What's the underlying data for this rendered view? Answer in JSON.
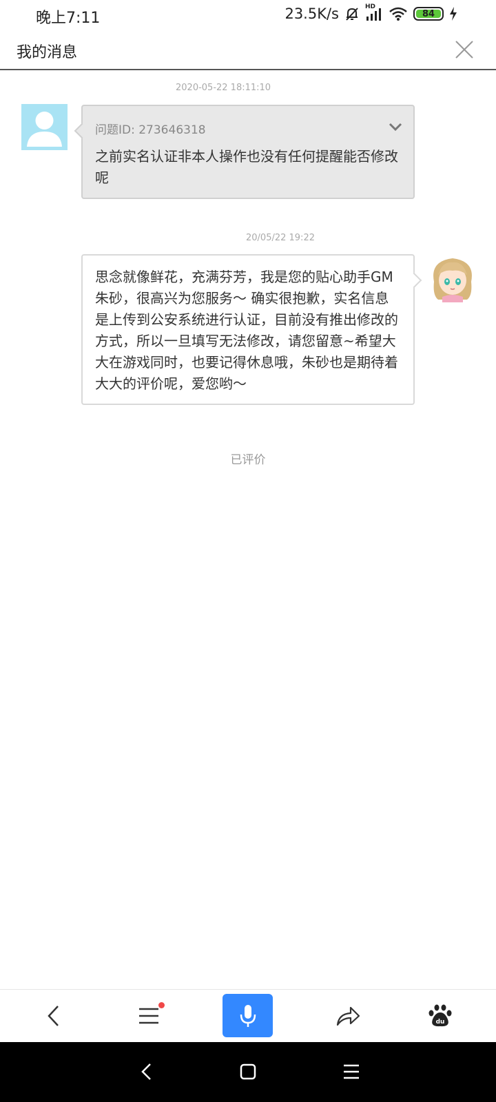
{
  "status": {
    "time": "晚上7:11",
    "net_speed": "23.5K/s",
    "battery": "84",
    "hd_label": "HD"
  },
  "header": {
    "title": "我的消息"
  },
  "messages": [
    {
      "timestamp": "2020-05-22 18:11:10",
      "question_id": "问题ID: 273646318",
      "text": "之前实名认证非本人操作也没有任何提醒能否修改呢"
    },
    {
      "timestamp": "20/05/22 19:22",
      "text": "思念就像鲜花，充满芬芳，我是您的贴心助手GM朱砂，很高兴为您服务～ 确实很抱歉，实名信息是上传到公安系统进行认证，目前没有推出修改的方式，所以一旦填写无法修改，请您留意~希望大大在游戏同时，也要记得休息哦，朱砂也是期待着大大的评价呢，爱您哟～"
    }
  ],
  "rated_label": "已评价",
  "colors": {
    "mic_button": "#3388ff",
    "user_avatar_bg": "#a9e3f4",
    "notification_dot": "#f04848",
    "battery_fill": "#5cc83a"
  },
  "icons": {
    "toolbar": [
      "back-icon",
      "menu-icon",
      "mic-icon",
      "share-icon",
      "baidu-paw-icon"
    ],
    "navbar": [
      "nav-back-icon",
      "nav-home-icon",
      "nav-recents-icon"
    ]
  }
}
